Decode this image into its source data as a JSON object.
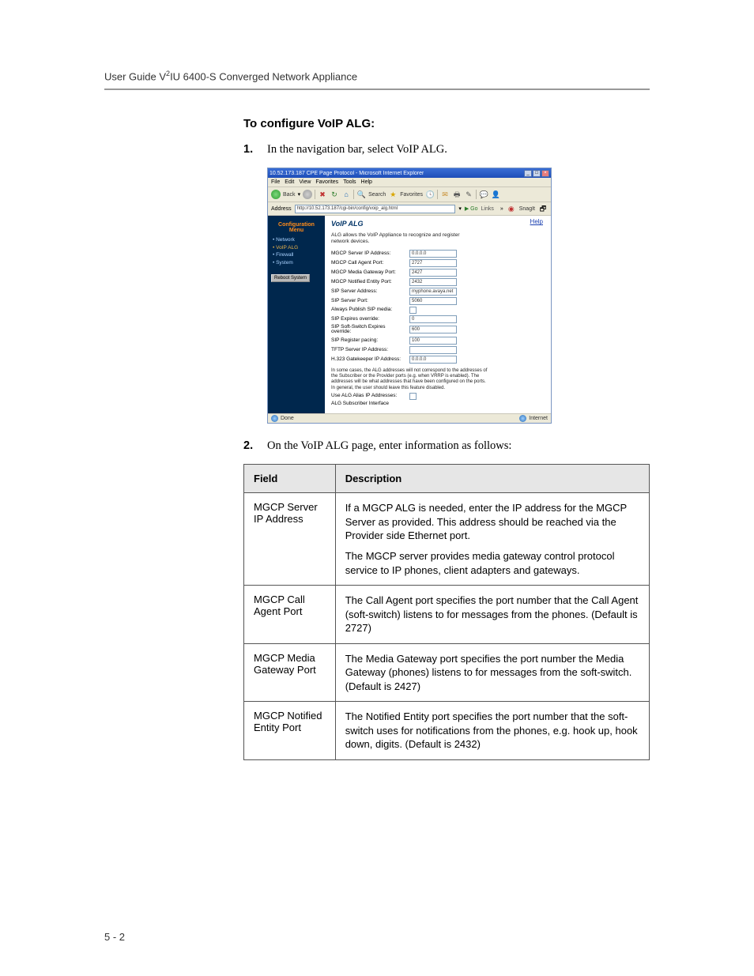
{
  "header": "User Guide V2IU 6400-S Converged Network Appliance",
  "section_heading": "To configure VoIP ALG:",
  "steps": [
    {
      "num": "1.",
      "text": "In the navigation bar, select VoIP ALG."
    },
    {
      "num": "2.",
      "text": "On the VoIP ALG page, enter information as follows:"
    }
  ],
  "screenshot": {
    "window_title": "10.52.173.187 CPE Page Protocol - Microsoft Internet Explorer",
    "menubar": [
      "File",
      "Edit",
      "View",
      "Favorites",
      "Tools",
      "Help"
    ],
    "toolbar": {
      "back": "Back",
      "search": "Search",
      "favorites": "Favorites"
    },
    "address_label": "Address",
    "address_value": "http://10.52.173.187/cgi-bin/config/voip_alg.html",
    "go": "Go",
    "links": "Links",
    "snagit_label": "SnagIt",
    "sidebar": {
      "heading": "Configuration Menu",
      "items": [
        "Network",
        "VoIP ALG",
        "Firewall",
        "System"
      ],
      "reboot": "Reboot System"
    },
    "main": {
      "title": "VoIP ALG",
      "help": "Help",
      "desc": "ALG allows the VoIP Appliance to recognize and register network devices.",
      "fields": [
        {
          "label": "MGCP Server IP Address:",
          "value": "0.0.0.0"
        },
        {
          "label": "MGCP Call Agent Port:",
          "value": "2727"
        },
        {
          "label": "MGCP Media Gateway Port:",
          "value": "2427"
        },
        {
          "label": "MGCP Notified Entity Port:",
          "value": "2432"
        },
        {
          "label": "SIP Server Address:",
          "value": "myphone.avaya.net"
        },
        {
          "label": "SIP Server Port:",
          "value": "5060"
        },
        {
          "label": "Always Publish SIP media:",
          "checkbox": true
        },
        {
          "label": "SIP Expires override:",
          "value": "0"
        },
        {
          "label": "SIP Soft-Switch Expires override:",
          "value": "600"
        },
        {
          "label": "SIP Register pacing:",
          "value": "100"
        },
        {
          "label": "TFTP Server IP Address:",
          "value": ""
        },
        {
          "label": "H.323 Gatekeeper IP Address:",
          "value": "0.0.0.0"
        }
      ],
      "note": "In some cases, the ALG addresses will not correspond to the addresses of the Subscriber or the Provider ports (e.g. when VRRP is enabled). The addresses will be what addresses that have been configured on the ports. In general, the user should leave this feature disabled.",
      "alias_label": "Use ALG Alias IP Addresses:",
      "sub_iface_label": "ALG Subscriber Interface"
    },
    "statusbar": {
      "done": "Done",
      "zone": "Internet"
    }
  },
  "table": {
    "headers": [
      "Field",
      "Description"
    ],
    "rows": [
      {
        "field": "MGCP Server IP Address",
        "desc": [
          "If a MGCP ALG is needed, enter the IP address for the MGCP Server as provided.  This address should be reached via the Provider side Ethernet port.",
          "The MGCP server provides media gateway control protocol service to IP phones, client adapters and gateways."
        ]
      },
      {
        "field": "MGCP Call Agent Port",
        "desc": [
          "The Call Agent port specifies the port number that the Call Agent (soft-switch) listens to for messages from the phones. (Default is 2727)"
        ]
      },
      {
        "field": "MGCP Media Gateway Port",
        "desc": [
          "The Media Gateway port specifies the port number the Media Gateway (phones) listens to for messages from the soft-switch. (Default is 2427)"
        ]
      },
      {
        "field": "MGCP Notified Entity Port",
        "desc": [
          "The Notified Entity port specifies the port number that the soft-switch uses for notifications from the phones, e.g. hook up, hook down, digits. (Default is 2432)"
        ]
      }
    ]
  },
  "page_num": "5 - 2"
}
